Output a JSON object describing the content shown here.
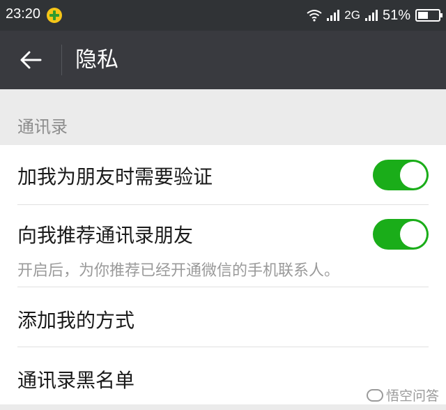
{
  "status_bar": {
    "time": "23:20",
    "network": "2G",
    "battery_text": "51%",
    "battery_level": 0.51
  },
  "header": {
    "title": "隐私"
  },
  "section": {
    "title": "通讯录"
  },
  "items": [
    {
      "label": "加我为朋友时需要验证",
      "toggle": true
    },
    {
      "label": "向我推荐通讯录朋友",
      "toggle": true,
      "description": "开启后，为你推荐已经开通微信的手机联系人。"
    },
    {
      "label": "添加我的方式"
    },
    {
      "label": "通讯录黑名单"
    }
  ],
  "watermark": {
    "text": "悟空问答"
  },
  "colors": {
    "toggle_on": "#1aad19",
    "app_bar": "#393a3f",
    "status_bar": "#303336"
  }
}
